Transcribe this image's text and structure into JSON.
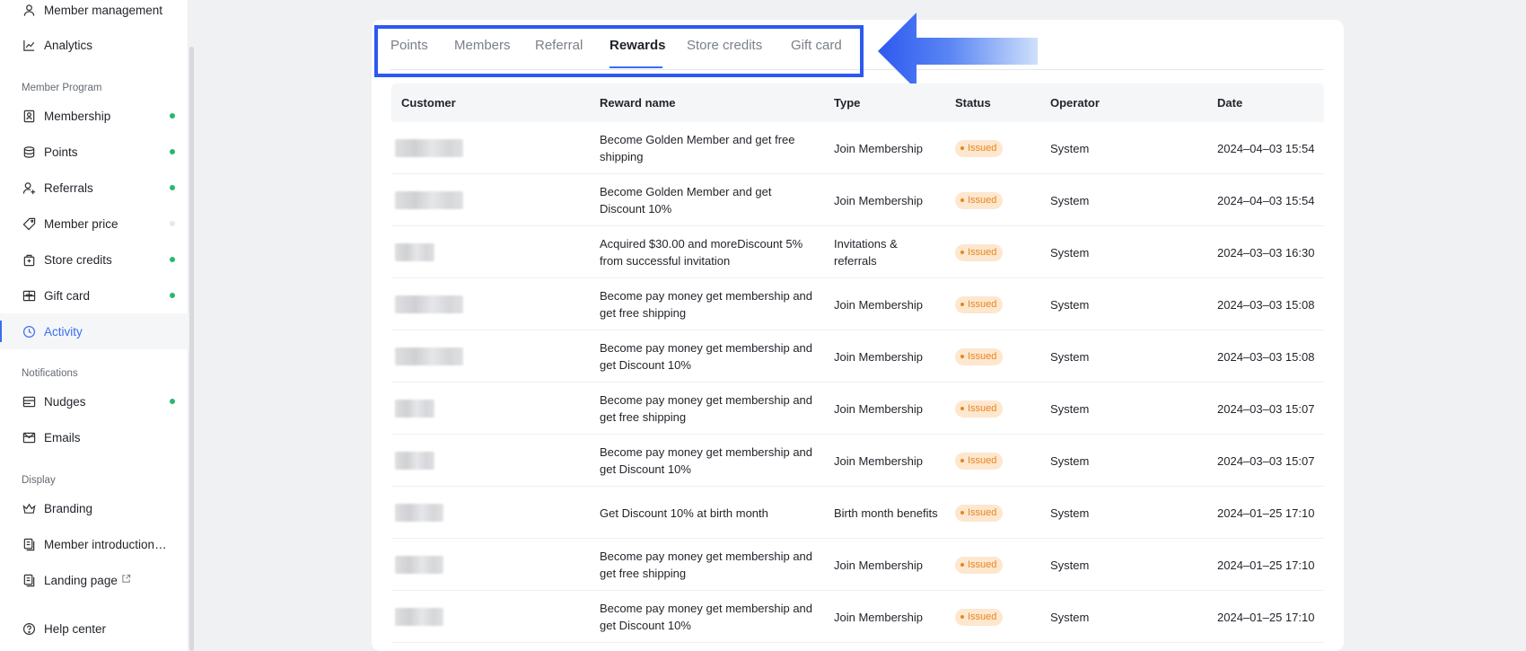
{
  "sidebar": {
    "items_top": [
      {
        "label": "Member management",
        "icon": "user-icon"
      },
      {
        "label": "Analytics",
        "icon": "chart-line-icon"
      }
    ],
    "sections": {
      "member_program": "Member Program",
      "notifications": "Notifications",
      "display": "Display"
    },
    "member_program": [
      {
        "label": "Membership",
        "icon": "badge-icon",
        "status": "on"
      },
      {
        "label": "Points",
        "icon": "coins-icon",
        "status": "on"
      },
      {
        "label": "Referrals",
        "icon": "user-plus-icon",
        "status": "on"
      },
      {
        "label": "Member price",
        "icon": "tag-icon",
        "status": "off"
      },
      {
        "label": "Store credits",
        "icon": "wallet-icon",
        "status": "on"
      },
      {
        "label": "Gift card",
        "icon": "gift-icon",
        "status": "on"
      },
      {
        "label": "Activity",
        "icon": "clock-icon",
        "status": "none"
      }
    ],
    "notifications": [
      {
        "label": "Nudges",
        "icon": "window-icon",
        "status": "on"
      },
      {
        "label": "Emails",
        "icon": "mail-icon",
        "status": "none"
      }
    ],
    "display": [
      {
        "label": "Branding",
        "icon": "crown-icon"
      },
      {
        "label": "Member introduction page",
        "icon": "pages-icon"
      },
      {
        "label": "Landing page",
        "icon": "pages-icon",
        "external": "external-link-icon"
      }
    ],
    "help": {
      "label": "Help center",
      "icon": "help-circle-icon"
    },
    "active": "Activity",
    "colors": {
      "accent": "#3b6cf6",
      "status_on": "#2bb673",
      "status_off": "#e6e8eb"
    }
  },
  "tabs": [
    {
      "label": "Points"
    },
    {
      "label": "Members"
    },
    {
      "label": "Referral"
    },
    {
      "label": "Rewards"
    },
    {
      "label": "Store credits"
    },
    {
      "label": "Gift card"
    }
  ],
  "active_tab": "Rewards",
  "annotation": {
    "color": "#2d59f0",
    "arrow_icon": "left-arrow-icon"
  },
  "table": {
    "columns": [
      "Customer",
      "Reward name",
      "Type",
      "Status",
      "Operator",
      "Date"
    ],
    "rows": [
      {
        "customer": "",
        "reward": "Become Golden Member and get free shipping",
        "type": "Join Membership",
        "status": "Issued",
        "operator": "System",
        "date": "2024–04–03 15:54"
      },
      {
        "customer": "",
        "reward": "Become Golden Member and get Discount 10%",
        "type": "Join Membership",
        "status": "Issued",
        "operator": "System",
        "date": "2024–04–03 15:54"
      },
      {
        "customer": "",
        "reward": "Acquired $30.00 and moreDiscount 5% from successful invitation",
        "type": "Invitations & referrals",
        "status": "Issued",
        "operator": "System",
        "date": "2024–03–03 16:30"
      },
      {
        "customer": "",
        "reward": "Become pay money get membership and get free shipping",
        "type": "Join Membership",
        "status": "Issued",
        "operator": "System",
        "date": "2024–03–03 15:08"
      },
      {
        "customer": "",
        "reward": "Become pay money get membership and get Discount 10%",
        "type": "Join Membership",
        "status": "Issued",
        "operator": "System",
        "date": "2024–03–03 15:08"
      },
      {
        "customer": "",
        "reward": "Become pay money get membership and get free shipping",
        "type": "Join Membership",
        "status": "Issued",
        "operator": "System",
        "date": "2024–03–03 15:07"
      },
      {
        "customer": "",
        "reward": "Become pay money get membership and get Discount 10%",
        "type": "Join Membership",
        "status": "Issued",
        "operator": "System",
        "date": "2024–03–03 15:07"
      },
      {
        "customer": "",
        "reward": "Get Discount 10% at birth month",
        "type": "Birth month benefits",
        "status": "Issued",
        "operator": "System",
        "date": "2024–01–25 17:10"
      },
      {
        "customer": "",
        "reward": "Become pay money get membership and get free shipping",
        "type": "Join Membership",
        "status": "Issued",
        "operator": "System",
        "date": "2024–01–25 17:10"
      },
      {
        "customer": "",
        "reward": "Become pay money get membership and get Discount 10%",
        "type": "Join Membership",
        "status": "Issued",
        "operator": "System",
        "date": "2024–01–25 17:10"
      }
    ]
  }
}
